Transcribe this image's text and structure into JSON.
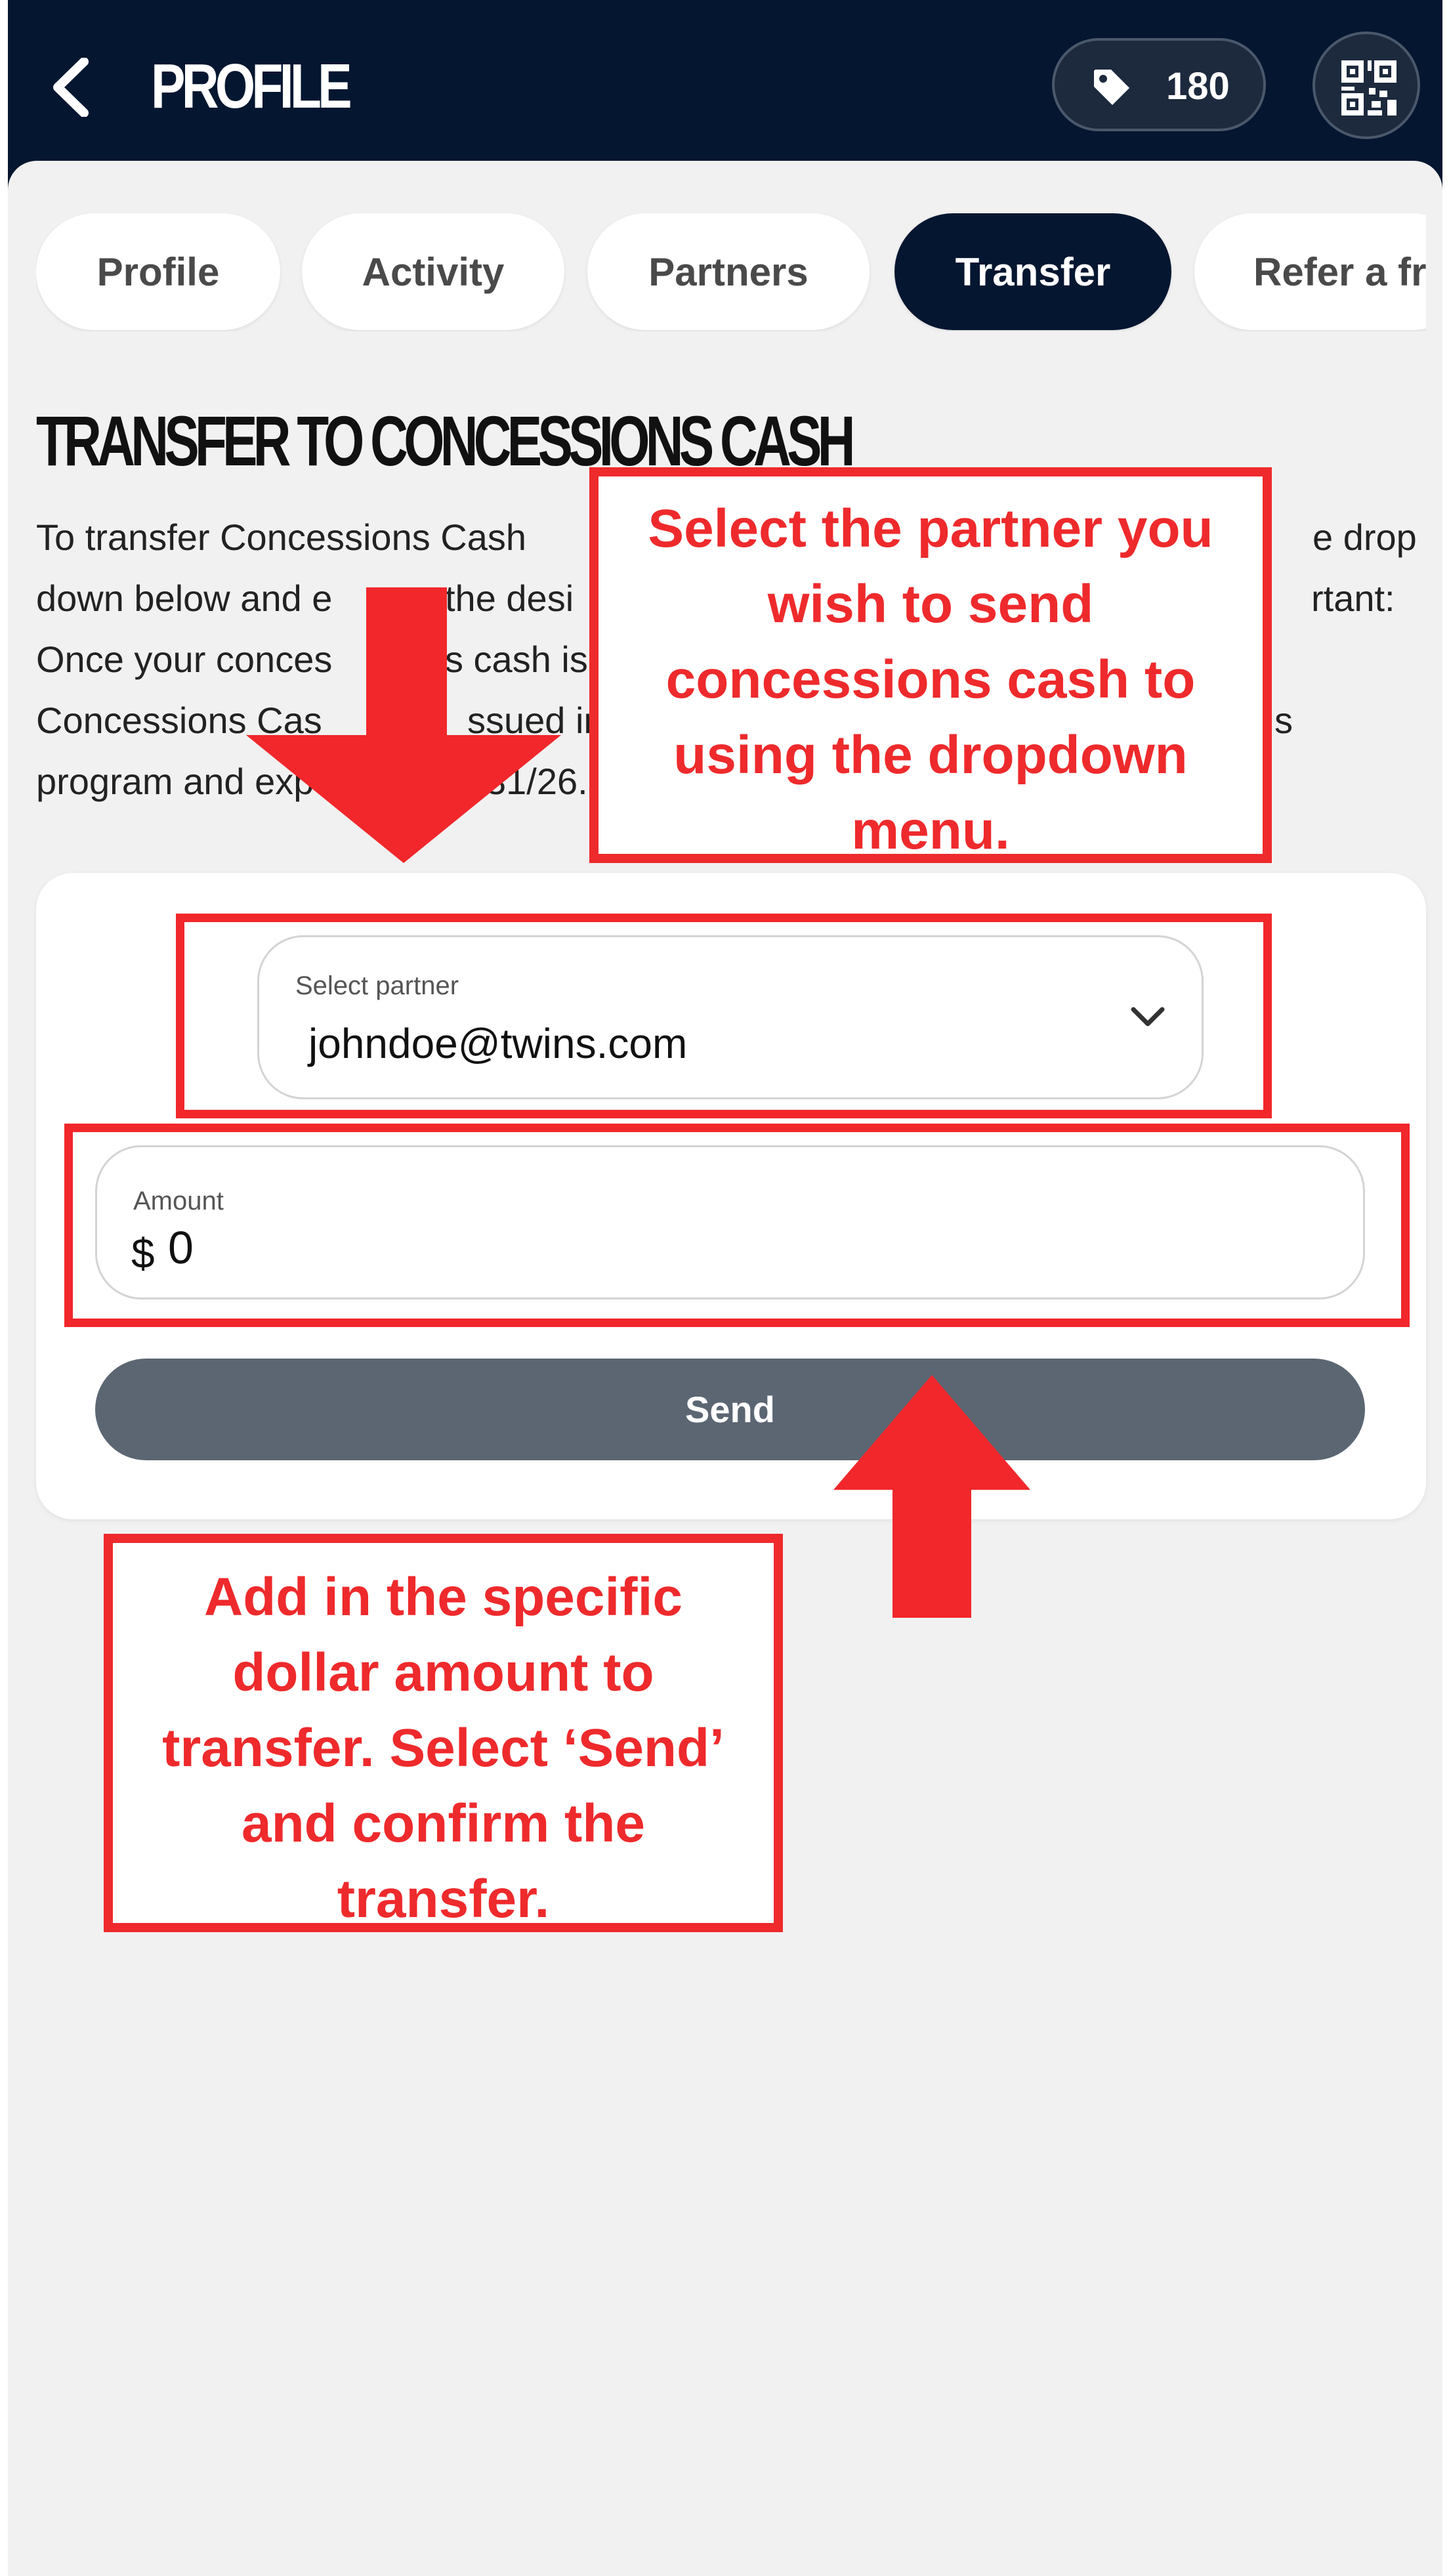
{
  "header": {
    "title": "PROFILE",
    "points": "180",
    "icons": [
      "back-chevron-icon",
      "tag-icon",
      "qr-code-icon"
    ]
  },
  "tabs": [
    {
      "label": "Profile",
      "active": false
    },
    {
      "label": "Activity",
      "active": false
    },
    {
      "label": "Partners",
      "active": false
    },
    {
      "label": "Transfer",
      "active": true
    },
    {
      "label": "Refer a fr",
      "active": false
    }
  ],
  "section": {
    "title": "TRANSFER TO CONCESSIONS CASH",
    "lines": [
      "To transfer Concessions Cash",
      "down below and e",
      "Once your conces",
      "Concessions Cas",
      "program and exp"
    ],
    "fragments": {
      "l1_right": "e drop",
      "l2_mid": "the desi",
      "l2_right": "rtant:",
      "l3_mid": "s cash is",
      "l4_mid": "ssued in",
      "l4_right": "s",
      "l5_mid": "31/26."
    }
  },
  "form": {
    "partner_label": "Select partner",
    "partner_value": "johndoe@twins.com",
    "amount_label": "Amount",
    "currency": "$",
    "amount_value": "0",
    "send_label": "Send"
  },
  "annotations": {
    "top": [
      "Select the partner you",
      "wish to send",
      "concessions cash to",
      "using the dropdown",
      "menu."
    ],
    "bottom": [
      "Add in the specific",
      "dollar amount to",
      "transfer. Select ‘Send’",
      "and confirm the",
      "transfer."
    ],
    "color": "#ee2a2c"
  },
  "colors": {
    "header_bg": "#041630",
    "active_tab": "#041630",
    "send_button": "#5c6673",
    "page_bg": "#f1f1f1"
  }
}
